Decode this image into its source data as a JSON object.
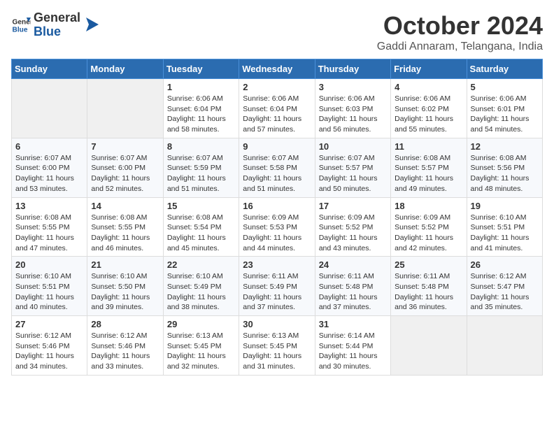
{
  "logo": {
    "general": "General",
    "blue": "Blue"
  },
  "header": {
    "month": "October 2024",
    "location": "Gaddi Annaram, Telangana, India"
  },
  "weekdays": [
    "Sunday",
    "Monday",
    "Tuesday",
    "Wednesday",
    "Thursday",
    "Friday",
    "Saturday"
  ],
  "weeks": [
    [
      {
        "day": "",
        "sunrise": "",
        "sunset": "",
        "daylight": ""
      },
      {
        "day": "",
        "sunrise": "",
        "sunset": "",
        "daylight": ""
      },
      {
        "day": "1",
        "sunrise": "Sunrise: 6:06 AM",
        "sunset": "Sunset: 6:04 PM",
        "daylight": "Daylight: 11 hours and 58 minutes."
      },
      {
        "day": "2",
        "sunrise": "Sunrise: 6:06 AM",
        "sunset": "Sunset: 6:04 PM",
        "daylight": "Daylight: 11 hours and 57 minutes."
      },
      {
        "day": "3",
        "sunrise": "Sunrise: 6:06 AM",
        "sunset": "Sunset: 6:03 PM",
        "daylight": "Daylight: 11 hours and 56 minutes."
      },
      {
        "day": "4",
        "sunrise": "Sunrise: 6:06 AM",
        "sunset": "Sunset: 6:02 PM",
        "daylight": "Daylight: 11 hours and 55 minutes."
      },
      {
        "day": "5",
        "sunrise": "Sunrise: 6:06 AM",
        "sunset": "Sunset: 6:01 PM",
        "daylight": "Daylight: 11 hours and 54 minutes."
      }
    ],
    [
      {
        "day": "6",
        "sunrise": "Sunrise: 6:07 AM",
        "sunset": "Sunset: 6:00 PM",
        "daylight": "Daylight: 11 hours and 53 minutes."
      },
      {
        "day": "7",
        "sunrise": "Sunrise: 6:07 AM",
        "sunset": "Sunset: 6:00 PM",
        "daylight": "Daylight: 11 hours and 52 minutes."
      },
      {
        "day": "8",
        "sunrise": "Sunrise: 6:07 AM",
        "sunset": "Sunset: 5:59 PM",
        "daylight": "Daylight: 11 hours and 51 minutes."
      },
      {
        "day": "9",
        "sunrise": "Sunrise: 6:07 AM",
        "sunset": "Sunset: 5:58 PM",
        "daylight": "Daylight: 11 hours and 51 minutes."
      },
      {
        "day": "10",
        "sunrise": "Sunrise: 6:07 AM",
        "sunset": "Sunset: 5:57 PM",
        "daylight": "Daylight: 11 hours and 50 minutes."
      },
      {
        "day": "11",
        "sunrise": "Sunrise: 6:08 AM",
        "sunset": "Sunset: 5:57 PM",
        "daylight": "Daylight: 11 hours and 49 minutes."
      },
      {
        "day": "12",
        "sunrise": "Sunrise: 6:08 AM",
        "sunset": "Sunset: 5:56 PM",
        "daylight": "Daylight: 11 hours and 48 minutes."
      }
    ],
    [
      {
        "day": "13",
        "sunrise": "Sunrise: 6:08 AM",
        "sunset": "Sunset: 5:55 PM",
        "daylight": "Daylight: 11 hours and 47 minutes."
      },
      {
        "day": "14",
        "sunrise": "Sunrise: 6:08 AM",
        "sunset": "Sunset: 5:55 PM",
        "daylight": "Daylight: 11 hours and 46 minutes."
      },
      {
        "day": "15",
        "sunrise": "Sunrise: 6:08 AM",
        "sunset": "Sunset: 5:54 PM",
        "daylight": "Daylight: 11 hours and 45 minutes."
      },
      {
        "day": "16",
        "sunrise": "Sunrise: 6:09 AM",
        "sunset": "Sunset: 5:53 PM",
        "daylight": "Daylight: 11 hours and 44 minutes."
      },
      {
        "day": "17",
        "sunrise": "Sunrise: 6:09 AM",
        "sunset": "Sunset: 5:52 PM",
        "daylight": "Daylight: 11 hours and 43 minutes."
      },
      {
        "day": "18",
        "sunrise": "Sunrise: 6:09 AM",
        "sunset": "Sunset: 5:52 PM",
        "daylight": "Daylight: 11 hours and 42 minutes."
      },
      {
        "day": "19",
        "sunrise": "Sunrise: 6:10 AM",
        "sunset": "Sunset: 5:51 PM",
        "daylight": "Daylight: 11 hours and 41 minutes."
      }
    ],
    [
      {
        "day": "20",
        "sunrise": "Sunrise: 6:10 AM",
        "sunset": "Sunset: 5:51 PM",
        "daylight": "Daylight: 11 hours and 40 minutes."
      },
      {
        "day": "21",
        "sunrise": "Sunrise: 6:10 AM",
        "sunset": "Sunset: 5:50 PM",
        "daylight": "Daylight: 11 hours and 39 minutes."
      },
      {
        "day": "22",
        "sunrise": "Sunrise: 6:10 AM",
        "sunset": "Sunset: 5:49 PM",
        "daylight": "Daylight: 11 hours and 38 minutes."
      },
      {
        "day": "23",
        "sunrise": "Sunrise: 6:11 AM",
        "sunset": "Sunset: 5:49 PM",
        "daylight": "Daylight: 11 hours and 37 minutes."
      },
      {
        "day": "24",
        "sunrise": "Sunrise: 6:11 AM",
        "sunset": "Sunset: 5:48 PM",
        "daylight": "Daylight: 11 hours and 37 minutes."
      },
      {
        "day": "25",
        "sunrise": "Sunrise: 6:11 AM",
        "sunset": "Sunset: 5:48 PM",
        "daylight": "Daylight: 11 hours and 36 minutes."
      },
      {
        "day": "26",
        "sunrise": "Sunrise: 6:12 AM",
        "sunset": "Sunset: 5:47 PM",
        "daylight": "Daylight: 11 hours and 35 minutes."
      }
    ],
    [
      {
        "day": "27",
        "sunrise": "Sunrise: 6:12 AM",
        "sunset": "Sunset: 5:46 PM",
        "daylight": "Daylight: 11 hours and 34 minutes."
      },
      {
        "day": "28",
        "sunrise": "Sunrise: 6:12 AM",
        "sunset": "Sunset: 5:46 PM",
        "daylight": "Daylight: 11 hours and 33 minutes."
      },
      {
        "day": "29",
        "sunrise": "Sunrise: 6:13 AM",
        "sunset": "Sunset: 5:45 PM",
        "daylight": "Daylight: 11 hours and 32 minutes."
      },
      {
        "day": "30",
        "sunrise": "Sunrise: 6:13 AM",
        "sunset": "Sunset: 5:45 PM",
        "daylight": "Daylight: 11 hours and 31 minutes."
      },
      {
        "day": "31",
        "sunrise": "Sunrise: 6:14 AM",
        "sunset": "Sunset: 5:44 PM",
        "daylight": "Daylight: 11 hours and 30 minutes."
      },
      {
        "day": "",
        "sunrise": "",
        "sunset": "",
        "daylight": ""
      },
      {
        "day": "",
        "sunrise": "",
        "sunset": "",
        "daylight": ""
      }
    ]
  ]
}
